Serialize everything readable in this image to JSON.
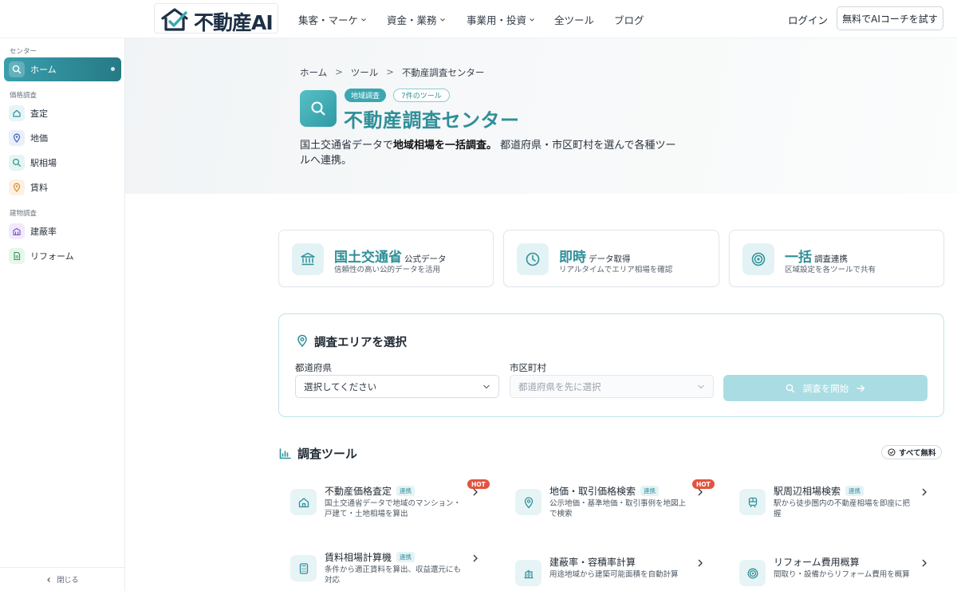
{
  "header": {
    "logo_text": "不動産AI",
    "nav": [
      {
        "label": "集客・マーケ",
        "has_menu": true
      },
      {
        "label": "資金・業務",
        "has_menu": true
      },
      {
        "label": "事業用・投資",
        "has_menu": true
      },
      {
        "label": "全ツール",
        "has_menu": false
      },
      {
        "label": "ブログ",
        "has_menu": false
      }
    ],
    "login": "ログイン",
    "cta": "無料でAIコーチを試す"
  },
  "sidebar": {
    "section_center": "センター",
    "home": "ホーム",
    "section_price": "価格調査",
    "price_items": [
      {
        "label": "査定",
        "icon": "house-icon"
      },
      {
        "label": "地価",
        "icon": "map-pin-icon"
      },
      {
        "label": "駅相場",
        "icon": "search-icon"
      },
      {
        "label": "賃料",
        "icon": "map-pin-icon"
      }
    ],
    "section_building": "建物調査",
    "building_items": [
      {
        "label": "建蔽率",
        "icon": "building-icon"
      },
      {
        "label": "リフォーム",
        "icon": "document-icon"
      }
    ],
    "close": "閉じる"
  },
  "breadcrumb": {
    "home": "ホーム",
    "tools": "ツール",
    "current": "不動産調査センター",
    "separator": ">"
  },
  "hero": {
    "badge_category": "地域調査",
    "badge_count": "7件のツール",
    "title": "不動産調査センター",
    "desc_1": "国土交通省データで",
    "desc_bold": "地域相場を一括調査。",
    "desc_2": " 都道府県・市区町村を選んで各種ツールへ連携。"
  },
  "features": [
    {
      "big": "国土交通省",
      "small": "公式データ",
      "sub": "信頼性の高い公的データを活用",
      "icon": "bank-icon"
    },
    {
      "big": "即時",
      "small": "データ取得",
      "sub": "リアルタイムでエリア相場を確認",
      "icon": "clock-icon"
    },
    {
      "big": "一括",
      "small": "調査連携",
      "sub": "区域設定を各ツールで共有",
      "icon": "target-icon"
    }
  ],
  "area": {
    "title": "調査エリアを選択",
    "pref_label": "都道府県",
    "pref_value": "選択してください",
    "city_label": "市区町村",
    "city_placeholder": "都道府県を先に選択",
    "submit": "調査を開始"
  },
  "tools": {
    "heading": "調査ツール",
    "free_badge": "すべて無料",
    "items": [
      {
        "name": "不動産価格査定",
        "tag": "連携",
        "desc": "国土交通省データで地域のマンション・戸建て・土地相場を算出",
        "hot": "HOT",
        "icon": "house-icon"
      },
      {
        "name": "地価・取引価格検索",
        "tag": "連携",
        "desc": "公示地価・基準地価・取引事例を地図上で検索",
        "hot": "HOT",
        "icon": "map-pin-icon"
      },
      {
        "name": "駅周辺相場検索",
        "tag": "連携",
        "desc": "駅から徒歩圏内の不動産相場を即座に把握",
        "hot": "",
        "icon": "train-icon"
      },
      {
        "name": "賃料相場計算機",
        "tag": "連携",
        "desc": "条件から適正賃料を算出、収益還元にも対応",
        "hot": "",
        "icon": "calculator-icon"
      },
      {
        "name": "建蔽率・容積率計算",
        "tag": "",
        "desc": "用途地域から建築可能面積を自動計算",
        "hot": "",
        "icon": "building-icon"
      },
      {
        "name": "リフォーム費用概算",
        "tag": "",
        "desc": "間取り・設備からリフォーム費用を概算",
        "hot": "",
        "icon": "target-icon"
      }
    ]
  },
  "colors": {
    "accent": "#2f8f99",
    "accent_light": "#e3f3f5",
    "hot": "#e2533f",
    "button_disabled": "#a9dde3"
  }
}
